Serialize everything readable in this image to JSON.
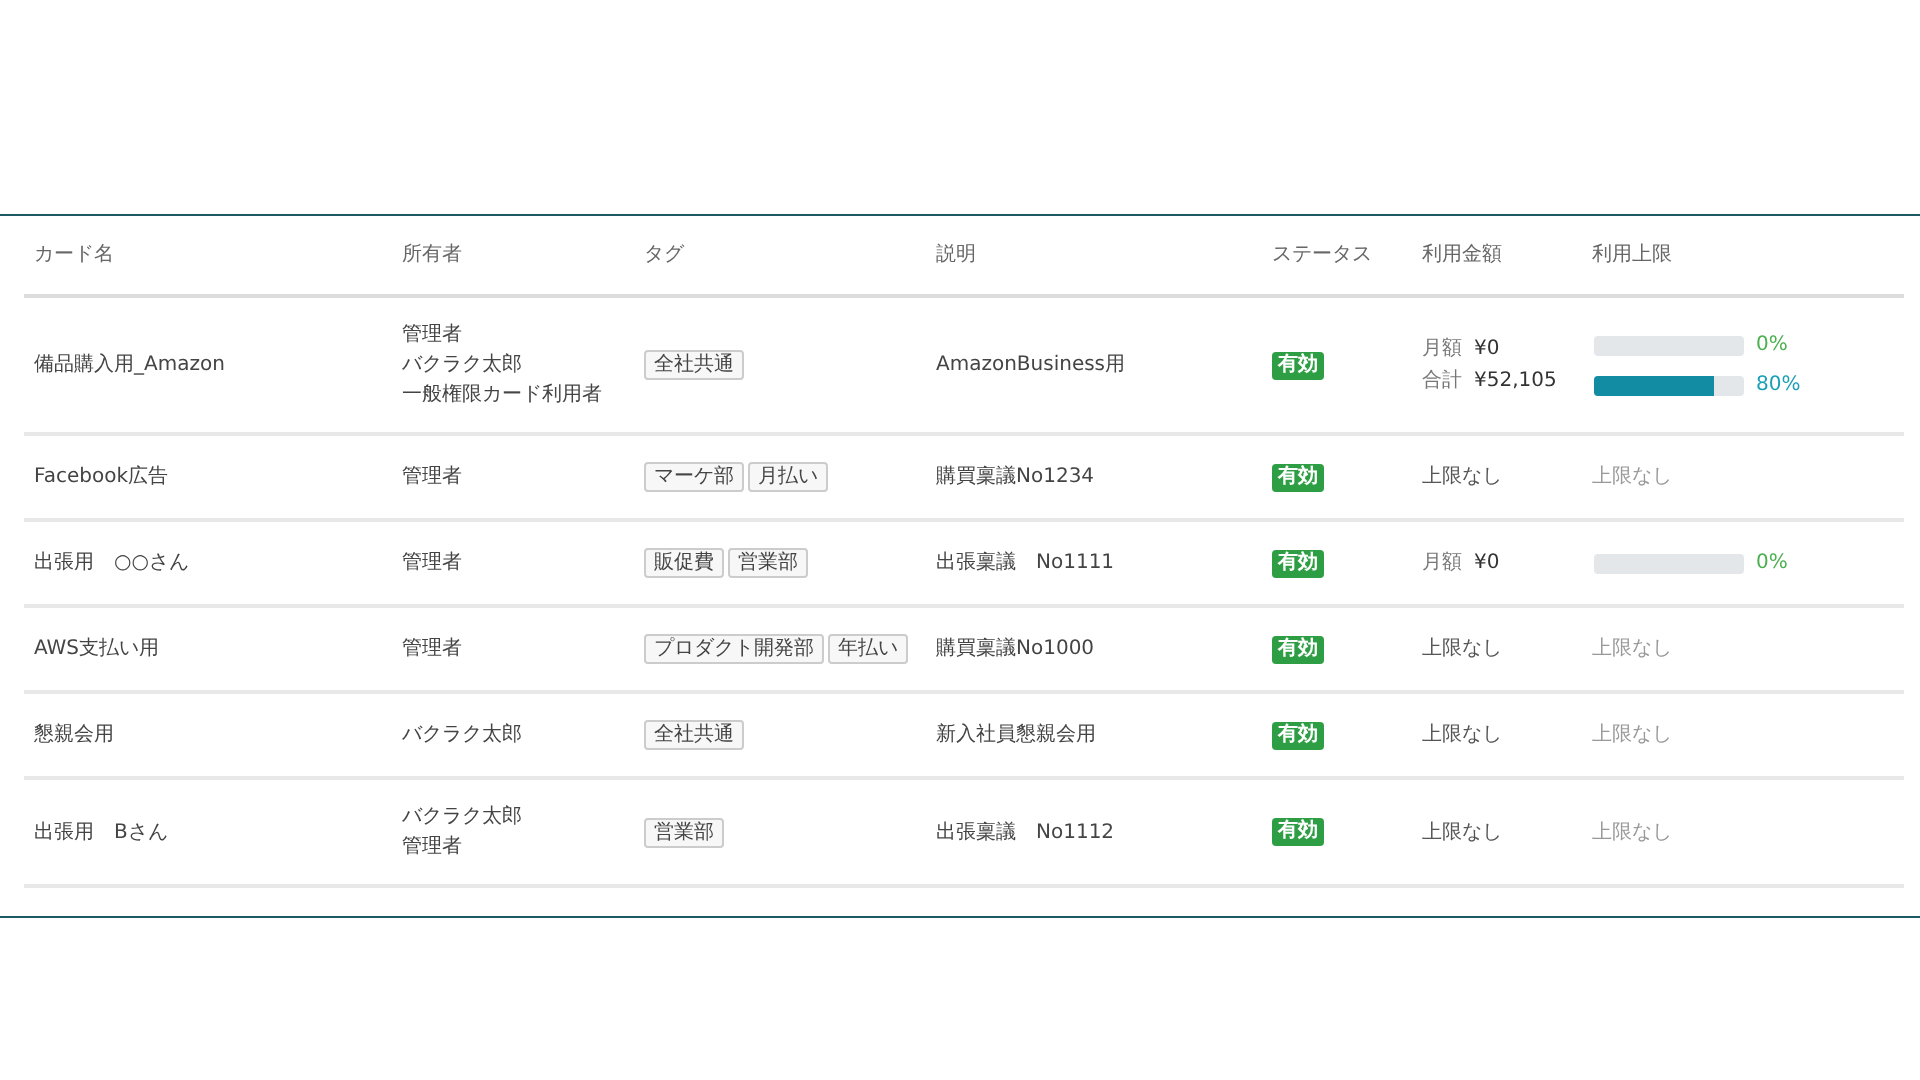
{
  "table": {
    "columns": [
      "カード名",
      "所有者",
      "タグ",
      "説明",
      "ステータス",
      "利用金額",
      "利用上限"
    ],
    "rows": [
      {
        "card_name": "備品購入用_Amazon",
        "owners": [
          "管理者",
          "バクラク太郎",
          "一般権限カード利用者"
        ],
        "tags": [
          "全社共通"
        ],
        "description": "AmazonBusiness用",
        "status": "有効",
        "amount": {
          "kind": "usage",
          "lines": [
            {
              "label": "月額",
              "value": "¥0"
            },
            {
              "label": "合計",
              "value": "¥52,105"
            }
          ]
        },
        "limit": {
          "kind": "bars",
          "bars": [
            {
              "level": 0,
              "reading": "0%",
              "color": "#4caf50"
            },
            {
              "level": 0.8,
              "reading": "80%",
              "color": "#1a9fb5"
            }
          ]
        }
      },
      {
        "card_name": "Facebook広告",
        "owners": [
          "管理者"
        ],
        "tags": [
          "マーケ部",
          "月払い"
        ],
        "description": "購買稟議No1234",
        "status": "有効",
        "amount": {
          "kind": "none",
          "text": "上限なし"
        },
        "limit": {
          "kind": "none",
          "text": "上限なし"
        }
      },
      {
        "card_name": "出張用　○○さん",
        "owners": [
          "管理者"
        ],
        "tags": [
          "販促費",
          "営業部"
        ],
        "description": "出張稟議　No1111",
        "status": "有効",
        "amount": {
          "kind": "usage",
          "lines": [
            {
              "label": "月額",
              "value": "¥0"
            }
          ]
        },
        "limit": {
          "kind": "bars",
          "bars": [
            {
              "level": 0,
              "reading": "0%",
              "color": "#4caf50"
            }
          ]
        }
      },
      {
        "card_name": "AWS支払い用",
        "owners": [
          "管理者"
        ],
        "tags": [
          "プロダクト開発部",
          "年払い"
        ],
        "description": "購買稟議No1000",
        "status": "有効",
        "amount": {
          "kind": "none",
          "text": "上限なし"
        },
        "limit": {
          "kind": "none",
          "text": "上限なし"
        }
      },
      {
        "card_name": "懇親会用",
        "owners": [
          "バクラク太郎"
        ],
        "tags": [
          "全社共通"
        ],
        "description": "新入社員懇親会用",
        "status": "有効",
        "amount": {
          "kind": "none",
          "text": "上限なし"
        },
        "limit": {
          "kind": "none",
          "text": "上限なし"
        }
      },
      {
        "card_name": "出張用　Bさん",
        "owners": [
          "バクラク太郎",
          "管理者"
        ],
        "tags": [
          "営業部"
        ],
        "description": "出張稟議　No1112",
        "status": "有効",
        "amount": {
          "kind": "none",
          "text": "上限なし"
        },
        "limit": {
          "kind": "none",
          "text": "上限なし"
        }
      }
    ]
  }
}
